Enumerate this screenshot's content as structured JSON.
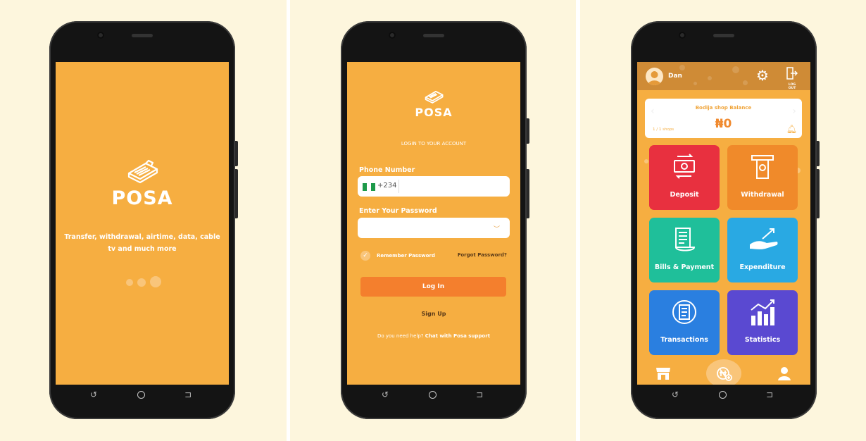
{
  "splash": {
    "app_name": "POSA",
    "tagline": "Transfer, withdrawal, airtime, data, cable tv and much more"
  },
  "login": {
    "app_name": "POSA",
    "subtitle": "LOGIN TO YOUR ACCOUNT",
    "phone_label": "Phone Number",
    "country_code": "+234",
    "phone_value": "",
    "password_label": "Enter Your Password",
    "password_value": "",
    "remember_label": "Remember Password",
    "forgot_label": "Forgot Password?",
    "login_button": "Log In",
    "signup_label": "Sign Up",
    "help_text": "Do you need help?",
    "help_link": "Chat with Posa support"
  },
  "dashboard": {
    "user_name": "Dan",
    "logout_label": "LOG OUT",
    "balance_title": "Bodija shop Balance",
    "balance_amount": "₦0",
    "shops_count": "1 / 1 shops",
    "tiles": [
      {
        "label": "Deposit",
        "color": "#e8303f",
        "icon": "deposit-cash-icon"
      },
      {
        "label": "Withdrawal",
        "color": "#f08a2a",
        "icon": "atm-withdrawal-icon"
      },
      {
        "label": "Bills & Payment",
        "color": "#1fbf9a",
        "icon": "receipt-icon"
      },
      {
        "label": "Expenditure",
        "color": "#29a9e3",
        "icon": "hand-arrow-icon"
      },
      {
        "label": "Transactions",
        "color": "#2a7fe0",
        "icon": "checklist-icon"
      },
      {
        "label": "Statistics",
        "color": "#5a49d1",
        "icon": "bar-chart-icon"
      }
    ]
  },
  "colors": {
    "page_bg": "#fdf6dd",
    "app_orange": "#f6ae41",
    "button_orange": "#f47f2d"
  }
}
